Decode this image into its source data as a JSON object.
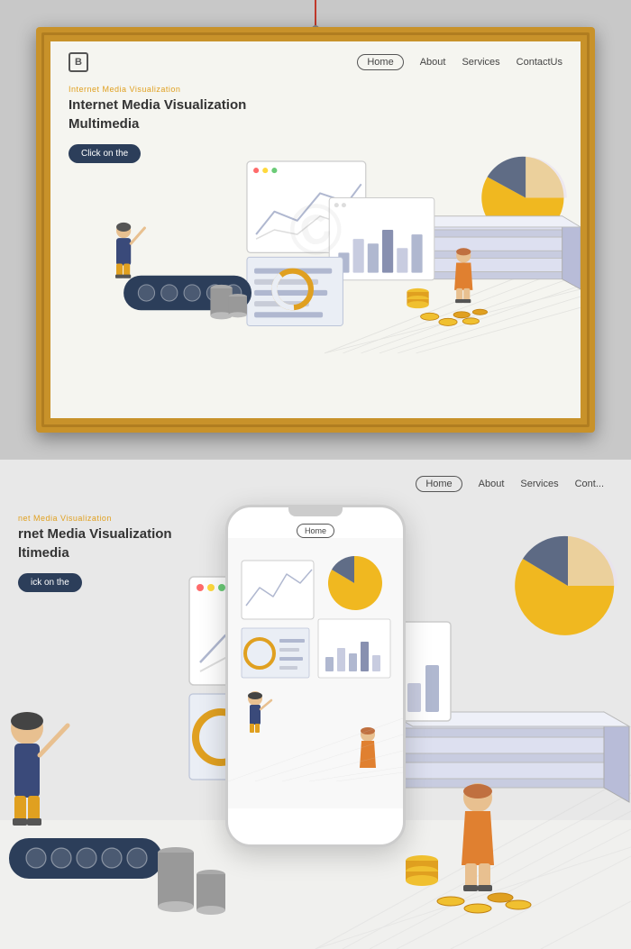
{
  "frame_section": {
    "alt": "Internet Media Visualization framed illustration"
  },
  "canvas": {
    "nav": {
      "logo": "B",
      "links": [
        {
          "label": "Home",
          "active": true
        },
        {
          "label": "About",
          "active": false
        },
        {
          "label": "Services",
          "active": false
        },
        {
          "label": "ContactUs",
          "active": false
        }
      ]
    },
    "headline": {
      "sub": "Internet Media Visualization",
      "main_line1": "Internet  Media  Visualization",
      "main_line2": "Multimedia",
      "cta": "Click on the"
    }
  },
  "bottom_section": {
    "nav": {
      "links": [
        {
          "label": "Home",
          "active": true
        },
        {
          "label": "About",
          "active": false
        },
        {
          "label": "Services",
          "active": false
        },
        {
          "label": "Cont...",
          "active": false
        }
      ]
    },
    "headline": {
      "sub": "net Media Visualization",
      "main_line1": "rnet  Media  Visualization",
      "main_line2": "ltimedia",
      "cta": "ick on the"
    },
    "phone": {
      "nav_label": "Home"
    }
  },
  "colors": {
    "accent_orange": "#e0a020",
    "accent_dark": "#2c3e5a",
    "accent_yellow": "#f0c030",
    "bar_color": "#b0b8d0",
    "pie_yellow": "#f0b820",
    "pie_dark": "#3a4a6a",
    "pie_light": "#e8e0f0",
    "wood": "#c8922a",
    "bg_light": "#f5f5f0"
  }
}
